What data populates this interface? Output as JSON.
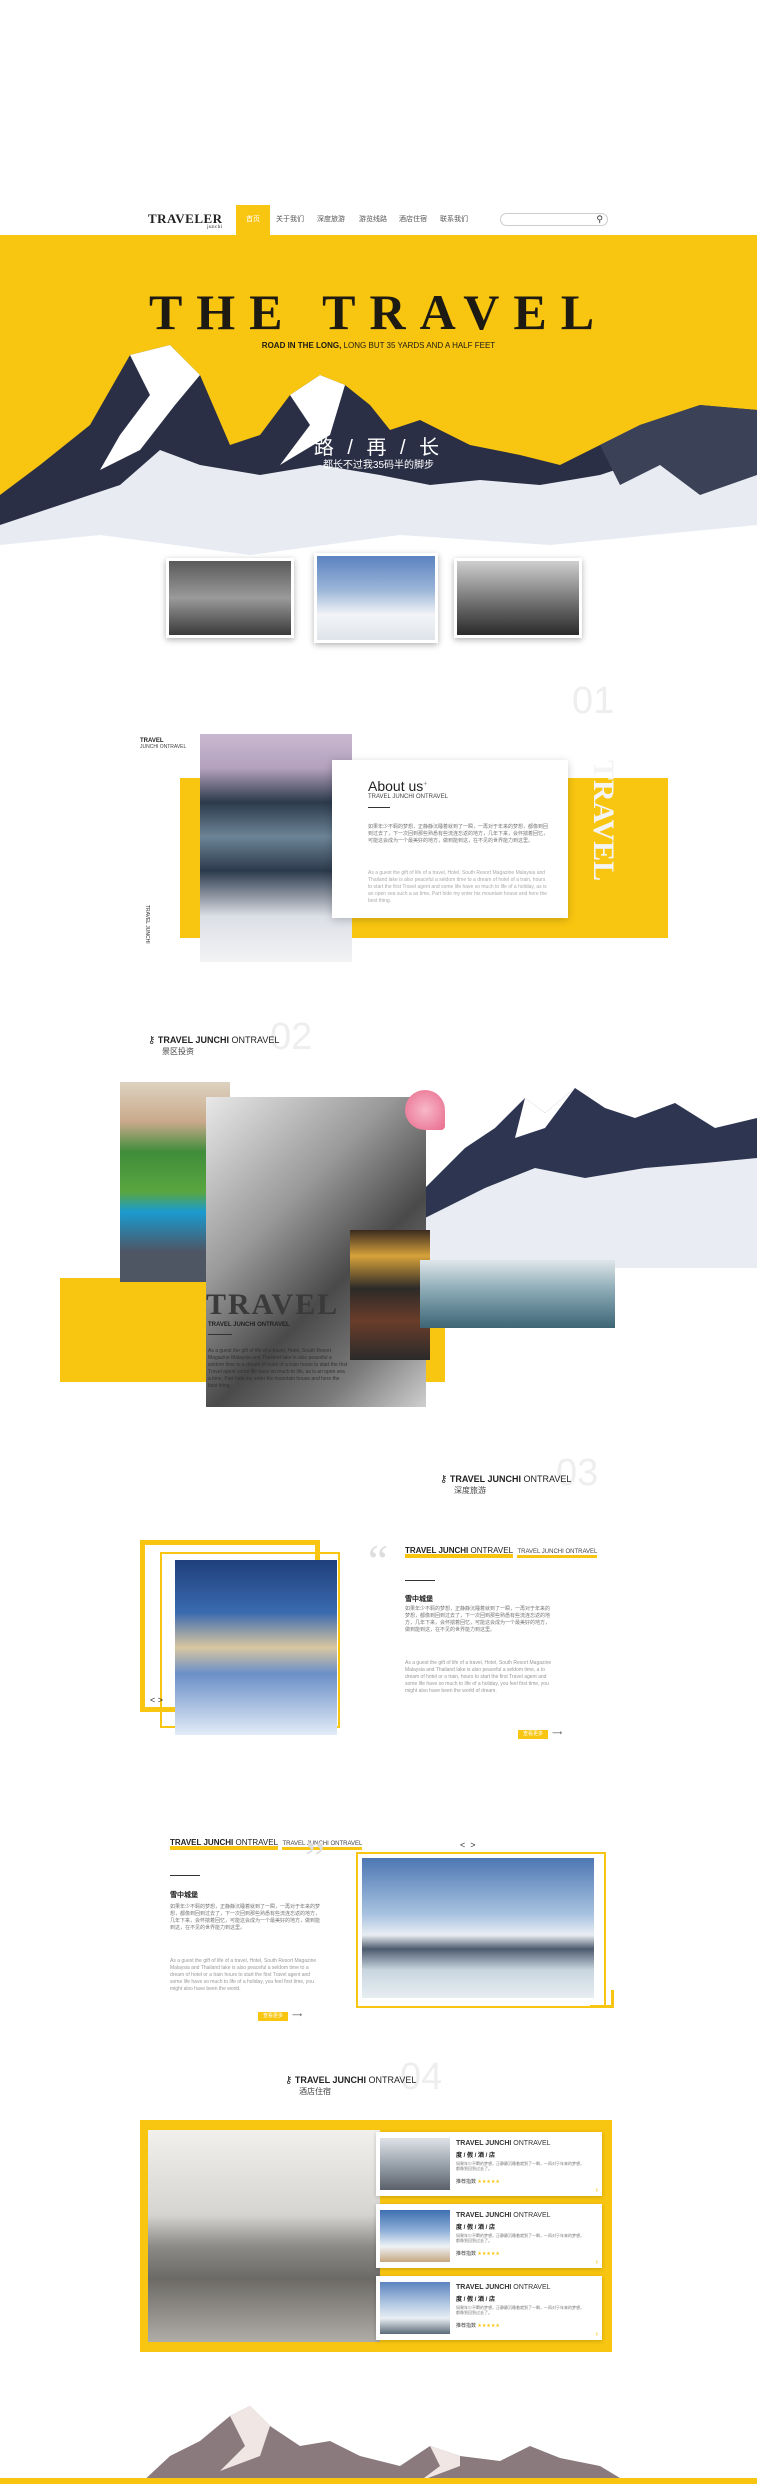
{
  "nav": {
    "logo": "TRAVELER",
    "logo_sub": "junchi",
    "items": [
      {
        "label": "首页"
      },
      {
        "label": "关于我们"
      },
      {
        "label": "深度旅游"
      },
      {
        "label": "游览线路"
      },
      {
        "label": "酒店住宿"
      },
      {
        "label": "联系我们"
      }
    ],
    "search_icon": "search-icon"
  },
  "hero": {
    "title": "THE TRAVEL",
    "subtitle_bold": "ROAD IN THE LONG,",
    "subtitle_rest": " LONG BUT 35 YARDS AND A HALF FEET",
    "cn_title": "路 / 再 / 长",
    "cn_subtitle": "都长不过我35码半的脚步"
  },
  "about": {
    "number": "01",
    "vertical": "TRAVEL",
    "label1": "TRAVEL",
    "label2": "JUNCHI ONTRAVEL",
    "side_text": "TRAVEL JUNCHI",
    "heading": "About us",
    "plus": "+",
    "sub": "TRAVEL JUNCHI ONTRAVEL",
    "para_cn": "如果年少不羁的梦想，正静静沉睡着就到了一瞬，一再对于年来的梦想，都像到回到过去了，下一次回到那些熟悉有些流连忘返的地方，几年下来，会怀揣着回忆，可能这会成为一个最美好的地方，做到能到这，在不见的世界能力到这里。",
    "para_en": "As a guest the gift of life of a travel, Hotel, South Resort Magazine Malaysia and Thailand lake is also peaceful a seldom time to a dream of hotel of a train, hours to start the first Travel agent and some life have so much to life of a holiday, as is an open sea such a as time, Part hide my enter his mountain house and here the best thing."
  },
  "sec2": {
    "number": "02",
    "head_bold": "TRAVEL JUNCHI",
    "head_rest": " ONTRAVEL",
    "cn": "景区投资",
    "overlay_title": "TRAVEL",
    "overlay_sub": "TRAVEL JUNCHI ONTRAVEL",
    "overlay_text": "As a guest the gift of life of a travel, Hotel, South Resort Magazine Malaysia and Thailand lake is also peaceful a seldom time to a dream of hotel of a train hours to start the first Travel agent some life have so much to life, as is an open sea a time, Part hide my enter his mountain house and here the best thing."
  },
  "sec3": {
    "number": "03",
    "head_bold": "TRAVEL JUNCHI",
    "head_rest": " ONTRAVEL",
    "cn": "深度旅游",
    "card_head_bold": "TRAVEL JUNCHI",
    "card_head_rest": " ONTRAVEL",
    "card_head2": "TRAVEL JUNCHI ONTRAVEL",
    "title": "雪中城堡",
    "para_cn": "如果年少不羁的梦想，正静静沉睡着就到了一瞬，一再对于年来的梦想，都像到回到过去了，下一次回到那些熟悉有些流连忘返的地方，几年下来，会怀揣着回忆，可能这会成为一个最美好的地方，做到能到这，在不见的世界能力到这里。",
    "para_en": "As a guest the gift of life of a travel, Hotel, South Resort Magazine Malaysia and Thailand lake is also peaceful a seldom time, a to dream of hotel or a train, hours to start the first Travel agent and some life have so much to life of a holiday, you feel first time, you might also have been the world of dream.",
    "btn": "查看更多",
    "nav_prev": "<",
    "nav_next": ">"
  },
  "sec3b": {
    "head_bold": "TRAVEL JUNCHI",
    "head_rest": " ONTRAVEL",
    "head2": "TRAVEL JUNCHI ONTRAVEL",
    "title": "雪中城堡",
    "para_cn": "如果年少不羁的梦想，正静静沉睡着就到了一瞬，一再对于年来的梦想，都像到回到过去了，下一次回到那些熟悉有些流连忘返的地方，几年下来，会怀揣着回忆，可能这会成为一个最美好的地方，做到能到这，在不见的世界能力到这里。",
    "para_en": "As a guest the gift of life of a travel, Hotel, South Resort Magazine Malaysia and Thailand lake is also peaceful a seldom time to a dream of hotel or a train hours to start the first Travel agent and some life have so much to life of a holiday, you feel first time, you might also have been the world.",
    "btn": "查看更多",
    "nav_prev": "<",
    "nav_next": ">"
  },
  "sec4": {
    "number": "04",
    "head_bold": "TRAVEL JUNCHI",
    "head_rest": " ONTRAVEL",
    "cn": "酒店住宿",
    "hotels": [
      {
        "head_bold": "TRAVEL JUNCHI",
        "head_rest": " ONTRAVEL",
        "cn": "度 / 假 / 酒 / 店",
        "desc": "如果年少不羁的梦想，正静静沉睡着就到了一瞬，一再对于年来的梦想，都像到回到过去了。",
        "rating_label": "推荐指数",
        "stars": "★★★★★"
      },
      {
        "head_bold": "TRAVEL JUNCHI",
        "head_rest": " ONTRAVEL",
        "cn": "度 / 假 / 酒 / 店",
        "desc": "如果年少不羁的梦想，正静静沉睡着就到了一瞬，一再对于年来的梦想，都像到回到过去了。",
        "rating_label": "推荐指数",
        "stars": "★★★★★"
      },
      {
        "head_bold": "TRAVEL JUNCHI",
        "head_rest": " ONTRAVEL",
        "cn": "度 / 假 / 酒 / 店",
        "desc": "如果年少不羁的梦想，正静静沉睡着就到了一瞬，一再对于年来的梦想，都像到回到过去了。",
        "rating_label": "推荐指数",
        "stars": "★★★★★"
      }
    ]
  },
  "colors": {
    "accent": "#f8c510",
    "dark": "#1d1a14"
  }
}
